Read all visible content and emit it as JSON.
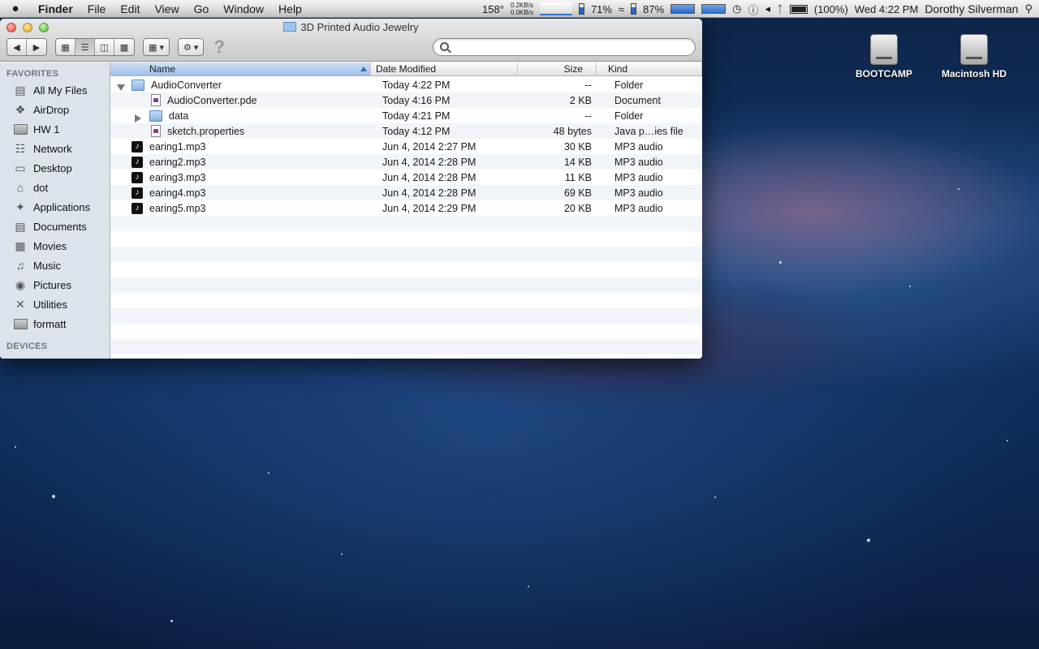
{
  "menubar": {
    "app": "Finder",
    "menus": [
      "File",
      "Edit",
      "View",
      "Go",
      "Window",
      "Help"
    ],
    "status": {
      "temp": "158°",
      "net_up": "0.2KB/s",
      "net_down": "0.0KB/s",
      "mem": "71%",
      "wifi_battery": "87%",
      "battery": "(100%)",
      "clock": "Wed 4:22 PM",
      "user": "Dorothy Silverman"
    }
  },
  "desktop": {
    "icons": [
      {
        "label": "BOOTCAMP"
      },
      {
        "label": "Macintosh HD"
      }
    ]
  },
  "window": {
    "title": "3D Printed Audio Jewelry",
    "search": {
      "value": "",
      "placeholder": ""
    },
    "sidebar": {
      "favorites_heading": "FAVORITES",
      "items": [
        {
          "label": "All My Files",
          "icon": "all-files-icon"
        },
        {
          "label": "AirDrop",
          "icon": "airdrop-icon"
        },
        {
          "label": "HW 1",
          "icon": "folder-icon"
        },
        {
          "label": "Network",
          "icon": "network-icon"
        },
        {
          "label": "Desktop",
          "icon": "desktop-icon"
        },
        {
          "label": "dot",
          "icon": "home-icon"
        },
        {
          "label": "Applications",
          "icon": "applications-icon"
        },
        {
          "label": "Documents",
          "icon": "documents-icon"
        },
        {
          "label": "Movies",
          "icon": "movies-icon"
        },
        {
          "label": "Music",
          "icon": "music-icon"
        },
        {
          "label": "Pictures",
          "icon": "pictures-icon"
        },
        {
          "label": "Utilities",
          "icon": "utilities-icon"
        },
        {
          "label": "formatt",
          "icon": "folder-icon"
        }
      ],
      "devices_heading": "DEVICES"
    },
    "columns": {
      "name": "Name",
      "date": "Date Modified",
      "size": "Size",
      "kind": "Kind"
    },
    "files": [
      {
        "name": "AudioConverter",
        "date": "Today 4:22 PM",
        "size": "--",
        "kind": "Folder",
        "type": "folder",
        "level": 0,
        "expanded": true
      },
      {
        "name": "AudioConverter.pde",
        "date": "Today 4:16 PM",
        "size": "2 KB",
        "kind": "Document",
        "type": "doc",
        "level": 1
      },
      {
        "name": "data",
        "date": "Today 4:21 PM",
        "size": "--",
        "kind": "Folder",
        "type": "folder",
        "level": 1,
        "expanded": false
      },
      {
        "name": "sketch.properties",
        "date": "Today 4:12 PM",
        "size": "48 bytes",
        "kind": "Java p…ies file",
        "type": "doc",
        "level": 1
      },
      {
        "name": "earing1.mp3",
        "date": "Jun 4, 2014 2:27 PM",
        "size": "30 KB",
        "kind": "MP3 audio",
        "type": "audio",
        "level": 0
      },
      {
        "name": "earing2.mp3",
        "date": "Jun 4, 2014 2:28 PM",
        "size": "14 KB",
        "kind": "MP3 audio",
        "type": "audio",
        "level": 0
      },
      {
        "name": "earing3.mp3",
        "date": "Jun 4, 2014 2:28 PM",
        "size": "11 KB",
        "kind": "MP3 audio",
        "type": "audio",
        "level": 0
      },
      {
        "name": "earing4.mp3",
        "date": "Jun 4, 2014 2:28 PM",
        "size": "69 KB",
        "kind": "MP3 audio",
        "type": "audio",
        "level": 0
      },
      {
        "name": "earing5.mp3",
        "date": "Jun 4, 2014 2:29 PM",
        "size": "20 KB",
        "kind": "MP3 audio",
        "type": "audio",
        "level": 0
      }
    ]
  }
}
